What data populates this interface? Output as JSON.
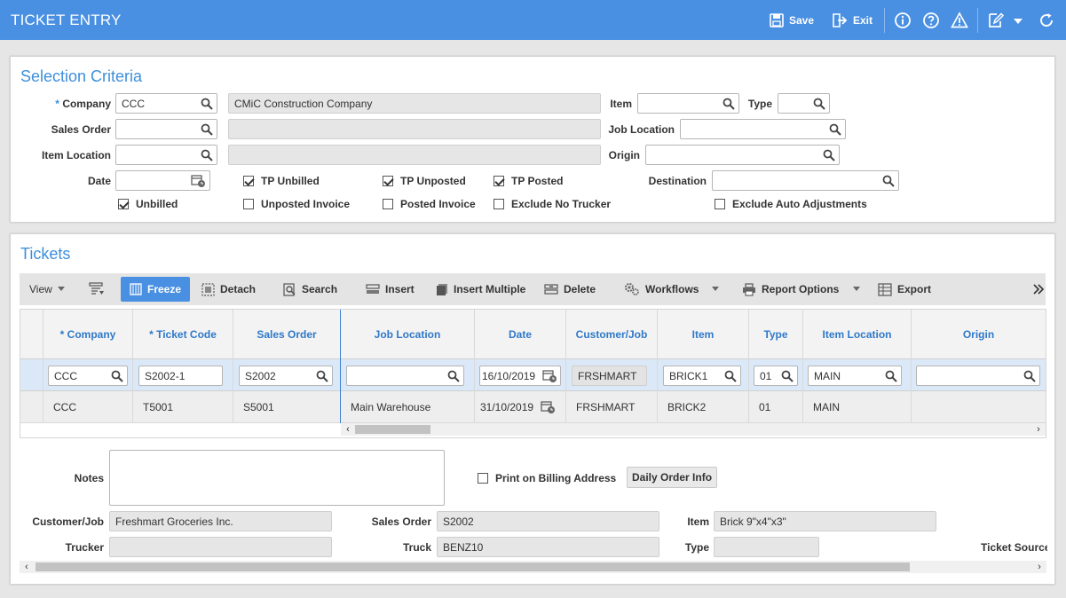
{
  "app": {
    "title": "TICKET ENTRY",
    "save_label": "Save",
    "exit_label": "Exit"
  },
  "selection": {
    "title": "Selection Criteria",
    "required_marker": "*",
    "company_label": "Company",
    "company_value": "CCC",
    "company_name": "CMiC Construction Company",
    "sales_order_label": "Sales Order",
    "item_location_label": "Item Location",
    "date_label": "Date",
    "item_label": "Item",
    "type_label": "Type",
    "job_location_label": "Job Location",
    "origin_label": "Origin",
    "destination_label": "Destination",
    "checkboxes": {
      "tp_unbilled": {
        "label": "TP Unbilled",
        "checked": true
      },
      "tp_unposted": {
        "label": "TP Unposted",
        "checked": true
      },
      "tp_posted": {
        "label": "TP Posted",
        "checked": true
      },
      "unbilled": {
        "label": "Unbilled",
        "checked": true
      },
      "unposted_invoice": {
        "label": "Unposted Invoice",
        "checked": false
      },
      "posted_invoice": {
        "label": "Posted Invoice",
        "checked": false
      },
      "exclude_no_trucker": {
        "label": "Exclude No Trucker",
        "checked": false
      },
      "exclude_auto_adjustments": {
        "label": "Exclude Auto Adjustments",
        "checked": false
      }
    }
  },
  "tickets": {
    "title": "Tickets",
    "toolbar": {
      "view": "View",
      "freeze": "Freeze",
      "detach": "Detach",
      "search": "Search",
      "insert": "Insert",
      "insert_multiple": "Insert Multiple",
      "delete": "Delete",
      "workflows": "Workflows",
      "report_options": "Report Options",
      "export": "Export"
    },
    "columns": [
      "* Company",
      "* Ticket Code",
      "Sales Order",
      "Job Location",
      "Date",
      "Customer/Job",
      "Item",
      "Type",
      "Item Location",
      "Origin"
    ],
    "rows": [
      {
        "company": "CCC",
        "ticket_code": "S2002-1",
        "sales_order": "S2002",
        "job_location": "",
        "date": "16/10/2019",
        "customer_job": "FRSHMART",
        "item": "BRICK1",
        "type": "01",
        "item_location": "MAIN",
        "origin": ""
      },
      {
        "company": "CCC",
        "ticket_code": "T5001",
        "sales_order": "S5001",
        "job_location": "Main Warehouse",
        "date": "31/10/2019",
        "customer_job": "FRSHMART",
        "item": "BRICK2",
        "type": "01",
        "item_location": "MAIN",
        "origin": ""
      }
    ]
  },
  "detail": {
    "notes_label": "Notes",
    "print_billing_label": "Print on Billing Address",
    "print_billing_checked": false,
    "daily_order_button": "Daily Order Info",
    "customer_job_label": "Customer/Job",
    "customer_job_value": "Freshmart Groceries Inc.",
    "sales_order_label": "Sales Order",
    "sales_order_value": "S2002",
    "item_label": "Item",
    "item_value": "Brick 9\"x4\"x3\"",
    "trucker_label": "Trucker",
    "truck_label": "Truck",
    "truck_value": "BENZ10",
    "type_label": "Type",
    "ticket_source_label": "Ticket Source"
  },
  "colors": {
    "header_blue": "#4a90e2",
    "title_blue": "#3d8fdc",
    "selected_row": "#dbe8f7"
  }
}
